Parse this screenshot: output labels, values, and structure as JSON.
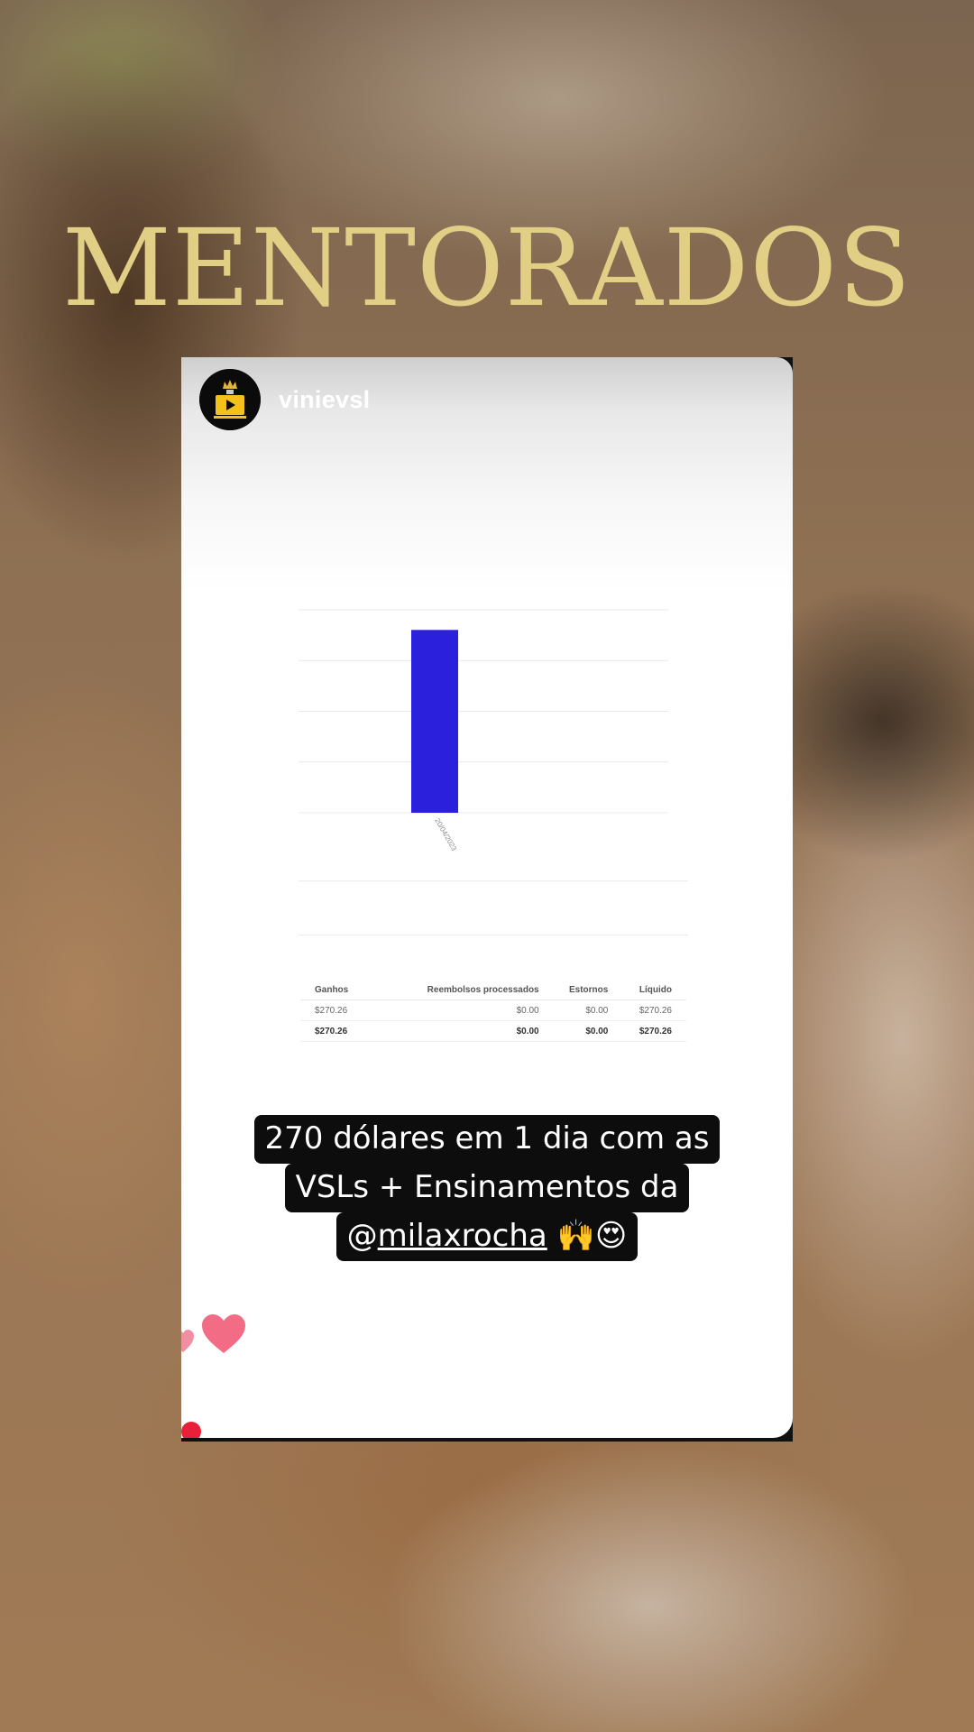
{
  "headline": "MENTORADOS",
  "story": {
    "username": "vinievsl",
    "avatar_icon": "crown-video-icon",
    "caption_lines": [
      "270 dólares em 1 dia com as",
      "VSLs + Ensinamentos da"
    ],
    "caption_mention_prefix": "@",
    "caption_mention": "milaxrocha",
    "caption_emoji": "🙌😍"
  },
  "chart_data": {
    "type": "bar",
    "categories": [
      "20/04/2023"
    ],
    "values": [
      270.26
    ],
    "ylim": [
      0,
      300
    ],
    "grid": true,
    "bar_color": "#2b21dd",
    "legend": "none"
  },
  "earnings_table": {
    "headers": [
      "Ganhos",
      "Reembolsos processados",
      "Estornos",
      "Líquido"
    ],
    "rows": [
      [
        "$270.26",
        "$0.00",
        "$0.00",
        "$270.26"
      ]
    ],
    "total": [
      "$270.26",
      "$0.00",
      "$0.00",
      "$270.26"
    ]
  },
  "colors": {
    "headline": "#e1cf85",
    "caption_bg": "#0d0d0d",
    "heart": "#f0607a"
  }
}
